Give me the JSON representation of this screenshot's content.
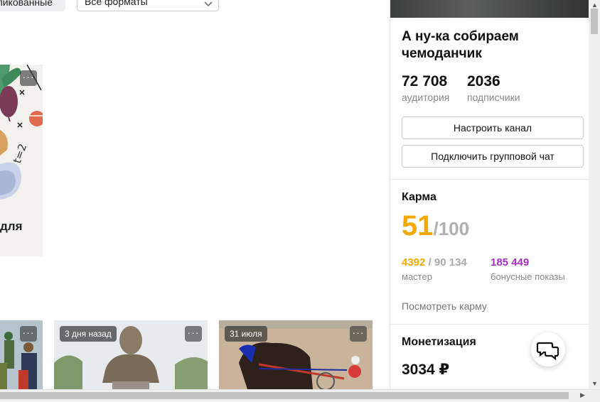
{
  "filters": {
    "published_label": "Опубликованные",
    "format_select": "Все форматы"
  },
  "feed": {
    "big_card_caption": "для",
    "cards": [
      {
        "badge": ""
      },
      {
        "badge": "3 дня назад"
      },
      {
        "badge": "31 июля"
      }
    ]
  },
  "channel": {
    "name": "А ну-ка собираем чемоданчик",
    "audience_value": "72 708",
    "audience_label": "аудитория",
    "subscribers_value": "2036",
    "subscribers_label": "подписчики",
    "configure_button": "Настроить канал",
    "group_chat_button": "Подключить групповой чат"
  },
  "karma": {
    "title": "Карма",
    "score": "51",
    "max": "/100",
    "master_value": "4392",
    "master_total": "/ 90 134",
    "master_label": "мастер",
    "bonus_value": "185 449",
    "bonus_label": "бонусные показы",
    "view_link": "Посмотреть карму",
    "score_color": "#f5a800",
    "bonus_color": "#a52fc4"
  },
  "monetization": {
    "title": "Монетизация",
    "amount": "3034 ₽"
  },
  "icons": {
    "more": "more-horizontal-icon",
    "chat": "chat-bubbles-icon",
    "chevron": "chevron-down-icon"
  }
}
